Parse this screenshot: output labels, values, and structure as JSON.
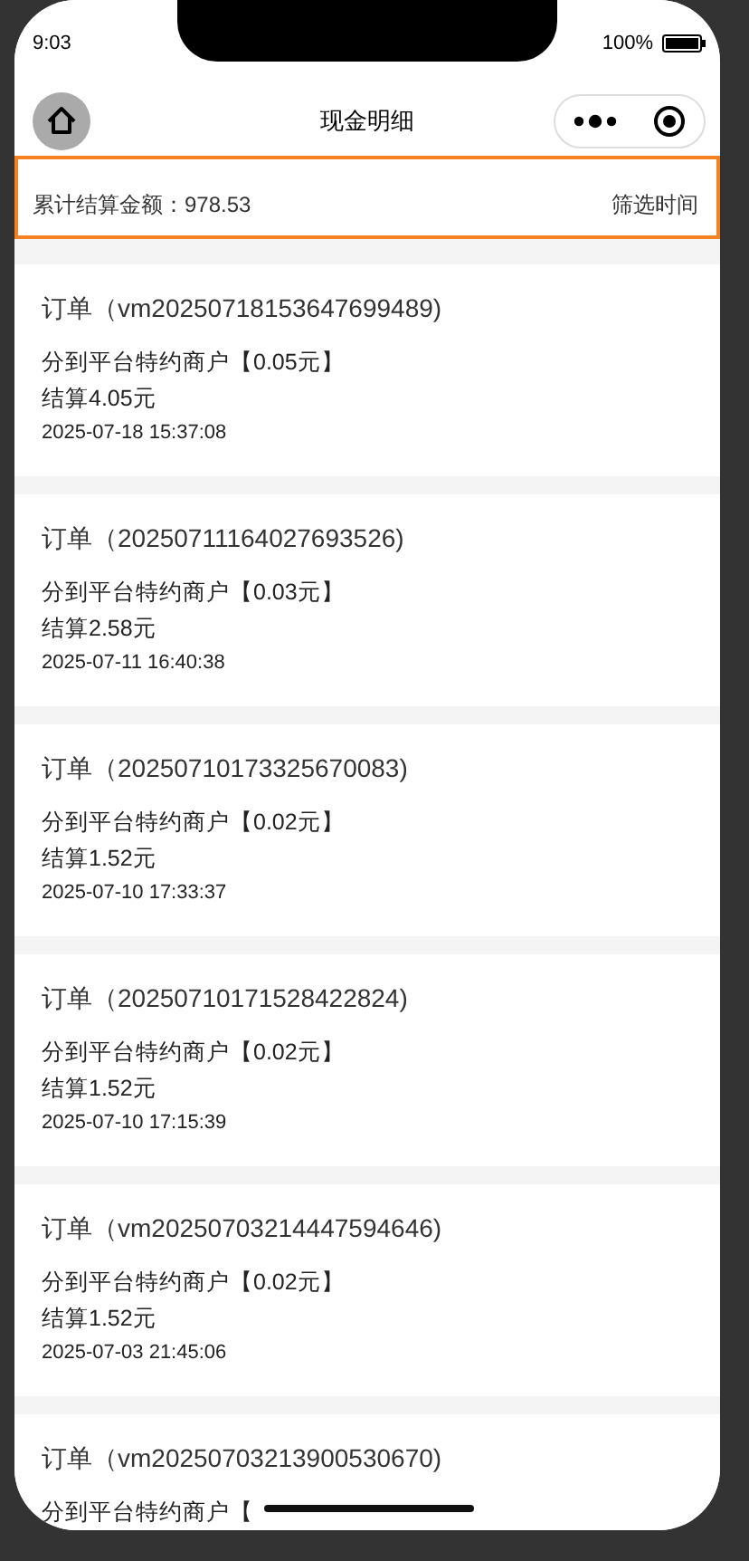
{
  "status_bar": {
    "time": "9:03",
    "battery": "100%"
  },
  "nav": {
    "title": "现金明细"
  },
  "summary": {
    "label": "累计结算金额：978.53",
    "filter": "筛选时间"
  },
  "orders": [
    {
      "title": "订单（vm20250718153647699489)",
      "merchant": "分到平台特约商户【0.05元】",
      "settle": "结算4.05元",
      "time": "2025-07-18 15:37:08"
    },
    {
      "title": "订单（20250711164027693526)",
      "merchant": "分到平台特约商户【0.03元】",
      "settle": "结算2.58元",
      "time": "2025-07-11 16:40:38"
    },
    {
      "title": "订单（20250710173325670083)",
      "merchant": "分到平台特约商户【0.02元】",
      "settle": "结算1.52元",
      "time": "2025-07-10 17:33:37"
    },
    {
      "title": "订单（20250710171528422824)",
      "merchant": "分到平台特约商户【0.02元】",
      "settle": "结算1.52元",
      "time": "2025-07-10 17:15:39"
    },
    {
      "title": "订单（vm20250703214447594646)",
      "merchant": "分到平台特约商户【0.02元】",
      "settle": "结算1.52元",
      "time": "2025-07-03 21:45:06"
    },
    {
      "title": "订单（vm20250703213900530670)",
      "merchant": "分到平台特约商户【"
    }
  ]
}
